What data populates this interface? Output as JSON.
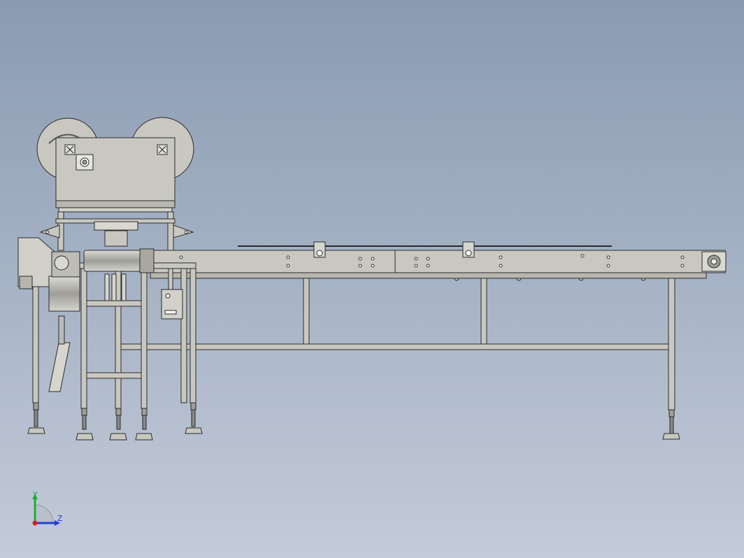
{
  "view": {
    "background_top": "#8a9bb2",
    "background_bottom": "#c4cbd8",
    "model_fill": "#c9c8c0",
    "model_fill_dark": "#a8a7a0",
    "edge_color": "#2b2b2b"
  },
  "triad": {
    "y_label": "Y",
    "z_label": "Z",
    "y_color": "#1faa3a",
    "z_color": "#1f3fd6",
    "x_color": "#d62020"
  }
}
